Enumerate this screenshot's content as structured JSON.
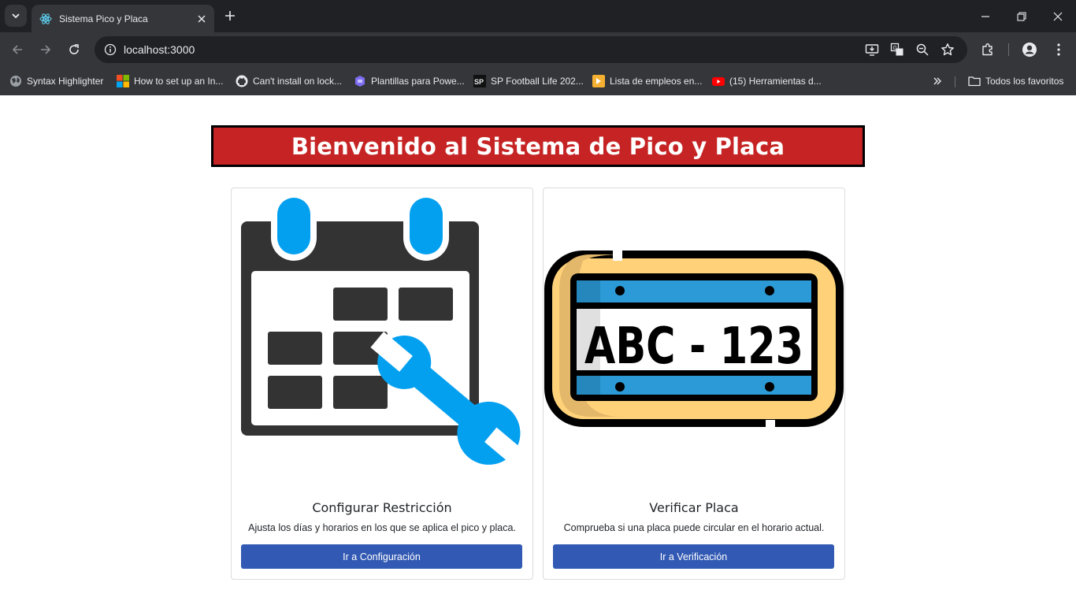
{
  "browser": {
    "tab_title": "Sistema Pico y Placa",
    "url": "localhost:3000",
    "bookmarks": [
      {
        "label": "Syntax Highlighter",
        "icon": "globe-icon"
      },
      {
        "label": "How to set up an In...",
        "icon": "microsoft-icon"
      },
      {
        "label": "Can't install on lock...",
        "icon": "github-icon"
      },
      {
        "label": "Plantillas para Powe...",
        "icon": "template-icon"
      },
      {
        "label": "SP Football Life 202...",
        "icon": "sp-icon"
      },
      {
        "label": "Lista de empleos en...",
        "icon": "jobs-icon"
      },
      {
        "label": "(15) Herramientas d...",
        "icon": "youtube-icon"
      }
    ],
    "all_bookmarks_label": "Todos los favoritos"
  },
  "page": {
    "heading": "Bienvenido al Sistema de Pico y Placa",
    "cards": [
      {
        "title": "Configurar Restricción",
        "description": "Ajusta los días y horarios en los que se aplica el pico y placa.",
        "button": "Ir a Configuración",
        "image": "calendar-wrench-icon"
      },
      {
        "title": "Verificar Placa",
        "description": "Comprueba si una placa puede circular en el horario actual.",
        "button": "Ir a Verificación",
        "image": "license-plate-icon",
        "plate_text": "ABC - 123"
      }
    ]
  },
  "colors": {
    "banner": "#c62424",
    "button": "#3259b3",
    "accent_blue": "#03a0f0"
  }
}
